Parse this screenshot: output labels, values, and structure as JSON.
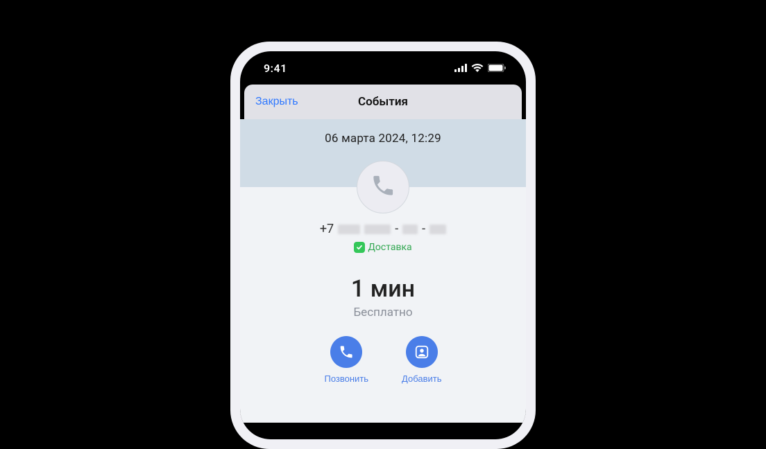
{
  "status": {
    "time": "9:41"
  },
  "nav": {
    "close_label": "Закрыть",
    "title": "События"
  },
  "event": {
    "datetime": "06 марта 2024, 12:29",
    "phone_prefix": "+7",
    "category_label": "Доставка",
    "duration": "1 мин",
    "cost": "Бесплатно"
  },
  "actions": {
    "call_label": "Позвонить",
    "add_label": "Добавить"
  }
}
